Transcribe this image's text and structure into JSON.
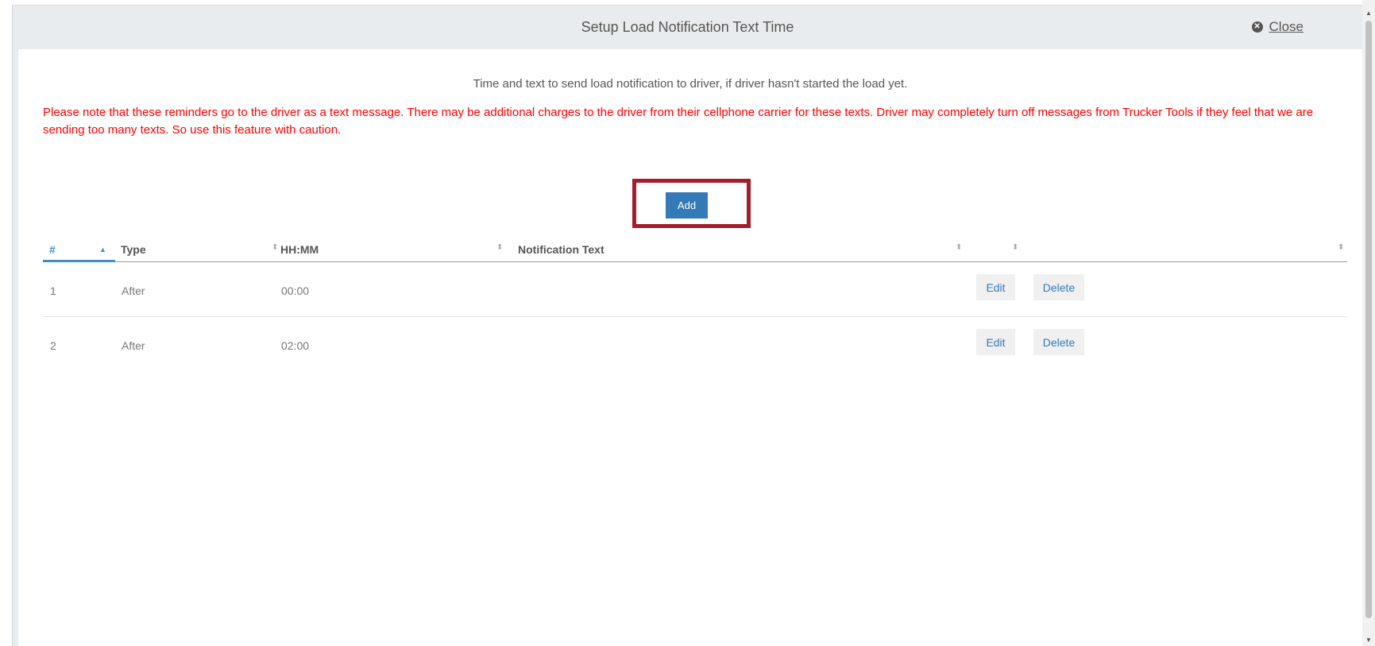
{
  "modal": {
    "title": "Setup Load Notification Text Time",
    "close_label": "Close",
    "close_icon": "close-circle-icon"
  },
  "info_text": "Time and text to send load notification to driver, if driver hasn't started the load yet.",
  "warning_text": "Please note that these reminders go to the driver as a text message. There may be additional charges to the driver from their cellphone carrier for these texts. Driver may completely turn off messages from Trucker Tools if they feel that we are sending too many texts. So use this feature with caution.",
  "add_label": "Add",
  "grid": {
    "columns": [
      {
        "label": "#",
        "sorted": "asc"
      },
      {
        "label": "Type"
      },
      {
        "label": "HH:MM"
      },
      {
        "label": "Notification Text"
      },
      {
        "label": ""
      },
      {
        "label": ""
      }
    ],
    "rows": [
      {
        "num": "1",
        "type": "After",
        "time": "00:00",
        "text": "",
        "edit": "Edit",
        "delete": "Delete"
      },
      {
        "num": "2",
        "type": "After",
        "time": "02:00",
        "text": "",
        "edit": "Edit",
        "delete": "Delete"
      }
    ]
  },
  "colors": {
    "accent": "#337ab7",
    "warning": "#ff0000",
    "highlight": "#a61c2a"
  }
}
